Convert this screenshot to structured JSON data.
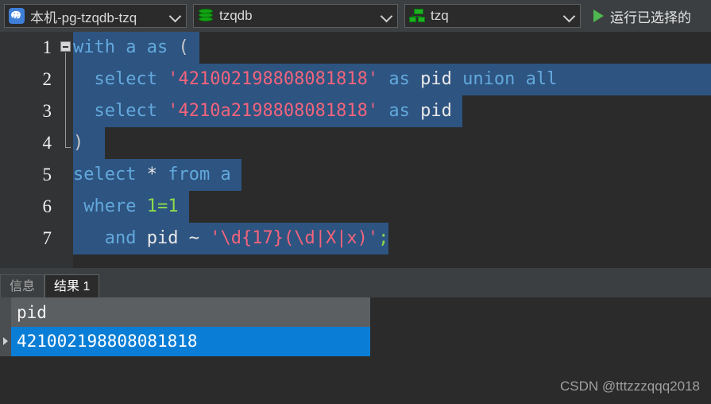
{
  "toolbar": {
    "connection": {
      "icon": "postgresql-elephant-icon",
      "label": "本机-pg-tzqdb-tzq"
    },
    "database": {
      "icon": "database-icon",
      "label": "tzqdb"
    },
    "schema": {
      "icon": "schema-icon",
      "label": "tzq"
    },
    "run_selected": {
      "icon": "play-icon",
      "label": "运行已选择的"
    }
  },
  "editor": {
    "line_numbers": [
      "1",
      "2",
      "3",
      "4",
      "5",
      "6",
      "7"
    ],
    "fold_marker": "collapse-minus-icon",
    "lines": [
      {
        "n": 1,
        "text": "with a as ("
      },
      {
        "n": 2,
        "text": "  select '421002198808081818' as pid union all"
      },
      {
        "n": 3,
        "text": "  select '4210a2198808081818' as pid"
      },
      {
        "n": 4,
        "text": ")"
      },
      {
        "n": 5,
        "text": "select * from a"
      },
      {
        "n": 6,
        "text": " where 1=1"
      },
      {
        "n": 7,
        "text": "   and pid ~ '\\d{17}(\\d|X|x)';"
      }
    ],
    "tokens": {
      "kw_with": "with",
      "id_a": "a",
      "kw_as": "as",
      "paren_open": "(",
      "paren_close": ")",
      "kw_select": "select",
      "str_pid_1": "'421002198808081818'",
      "str_pid_2": "'4210a2198808081818'",
      "id_pid": "pid",
      "kw_union": "union",
      "kw_all": "all",
      "star": "*",
      "kw_from": "from",
      "kw_where": "where",
      "num_one": "1",
      "eq": "=",
      "kw_and": "and",
      "tilde": "~",
      "str_regex": "'\\d{17}(\\d|X|x)'",
      "semicolon": ";"
    },
    "colors": {
      "background": "#2b2b2b",
      "gutter": "#313335",
      "selection": "#2e5481",
      "keyword": "#62a9dc",
      "string": "#f2647c",
      "number": "#8cdb4c",
      "identifier": "#e8e8e8"
    }
  },
  "tabs": [
    {
      "label": "信息",
      "active": false
    },
    {
      "label": "结果 1",
      "active": true
    }
  ],
  "result_grid": {
    "columns": [
      "pid"
    ],
    "rows": [
      [
        "421002198808081818"
      ]
    ],
    "selected_row": 0,
    "row_indicator": "row-pointer-icon",
    "selection_color": "#0a7ed6",
    "header_color": "#5c5f61"
  },
  "watermark": "CSDN @tttzzzqqq2018"
}
